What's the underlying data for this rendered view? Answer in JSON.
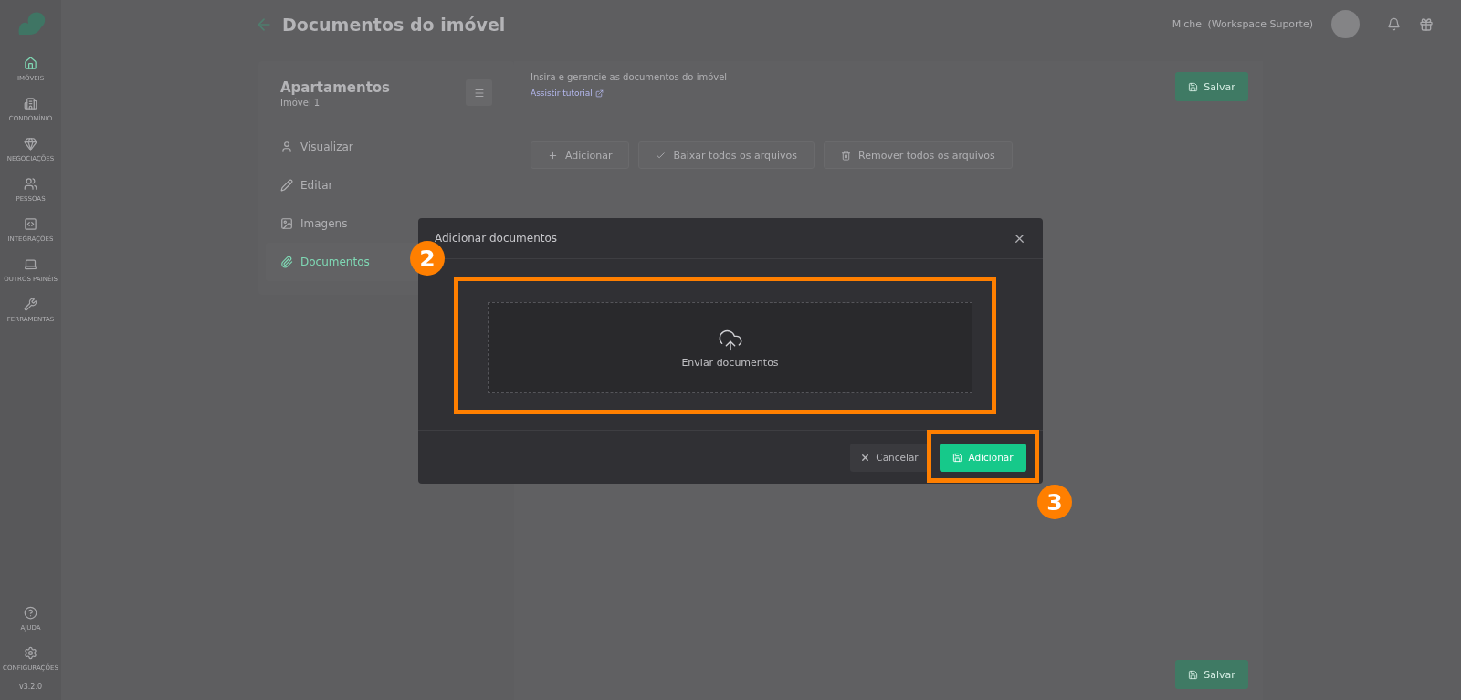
{
  "sidebar": {
    "items": [
      {
        "label": "IMÓVEIS",
        "selected": true
      },
      {
        "label": "CONDOMÍNIO",
        "selected": false
      },
      {
        "label": "NEGOCIAÇÕES",
        "selected": false
      },
      {
        "label": "PESSOAS",
        "selected": false
      },
      {
        "label": "INTEGRAÇÕES",
        "selected": false
      },
      {
        "label": "OUTROS PAINÉIS",
        "selected": false
      },
      {
        "label": "FERRAMENTAS",
        "selected": false
      }
    ],
    "bottom_items": [
      {
        "label": "AJUDA"
      },
      {
        "label": "CONFIGURAÇÕES"
      }
    ],
    "version": "v3.2.0"
  },
  "header": {
    "title": "Documentos do imóvel",
    "user": "Michel (Workspace Suporte)"
  },
  "property_card": {
    "title": "Apartamentos",
    "subtitle": "Imóvel 1",
    "items": [
      {
        "label": "Visualizar",
        "selected": false
      },
      {
        "label": "Editar",
        "selected": false
      },
      {
        "label": "Imagens",
        "selected": false
      },
      {
        "label": "Documentos",
        "selected": true
      }
    ]
  },
  "content": {
    "description": "Insira e gerencie as documentos do imóvel",
    "tutorial_link": "Assistir tutorial",
    "save_button": "Salvar",
    "actions": [
      "Adicionar",
      "Baixar todos os arquivos",
      "Remover todos os arquivos"
    ],
    "bottom_save_button": "Salvar"
  },
  "modal": {
    "title": "Adicionar documentos",
    "dropzone_label": "Enviar documentos",
    "cancel_button": "Cancelar",
    "confirm_button": "Adicionar"
  },
  "annotations": [
    "2",
    "3"
  ]
}
